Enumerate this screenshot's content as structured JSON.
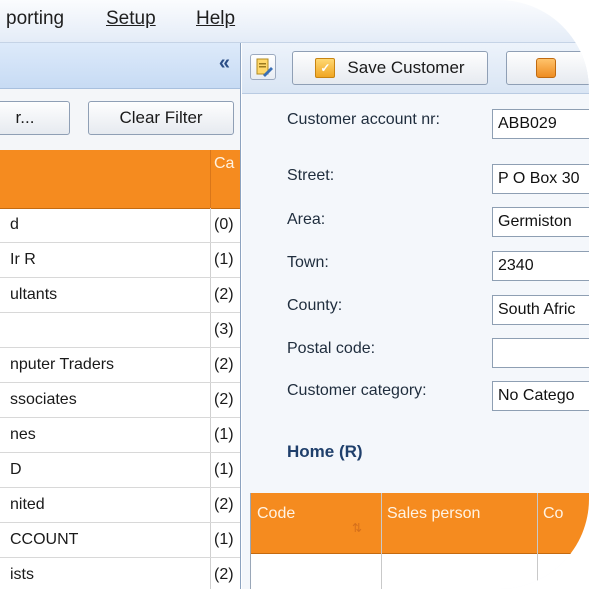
{
  "menu": {
    "reporting": "porting",
    "setup": "Setup",
    "help": "Help"
  },
  "left_panel": {
    "collapse_glyph": "«",
    "filter_button": "r...",
    "clear_filter_button": "Clear Filter",
    "category_column": "Ca",
    "rows": [
      {
        "name": "d",
        "count": "(0)"
      },
      {
        "name": "Ir R",
        "count": "(1)"
      },
      {
        "name": "ultants",
        "count": "(2)"
      },
      {
        "name": "",
        "count": "(3)"
      },
      {
        "name": "nputer Traders",
        "count": "(2)"
      },
      {
        "name": "ssociates",
        "count": "(2)"
      },
      {
        "name": "nes",
        "count": "(1)"
      },
      {
        "name": "D",
        "count": "(1)"
      },
      {
        "name": "nited",
        "count": "(2)"
      },
      {
        "name": "CCOUNT",
        "count": "(1)"
      },
      {
        "name": "ists",
        "count": "(2)"
      }
    ]
  },
  "toolbar": {
    "save_customer": "Save Customer",
    "icons": [
      "edit-document-icon",
      "save-icon",
      "refresh-icon"
    ]
  },
  "form": {
    "account_label": "Customer account nr:",
    "account_value": "ABB029",
    "street_label": "Street:",
    "street_value": "P O Box 30",
    "area_label": "Area:",
    "area_value": "Germiston",
    "town_label": "Town:",
    "town_value": "2340",
    "county_label": "County:",
    "county_value": "South Afric",
    "postal_label": "Postal code:",
    "postal_value": "",
    "category_label": "Customer category:",
    "category_value": "No Catego"
  },
  "home_section": {
    "title": "Home (R)",
    "columns": [
      "Code",
      "Sales person",
      "Co"
    ]
  },
  "colors": {
    "accent_orange": "#f58b1f",
    "header_blue": "#d9e5f4",
    "title_blue": "#1f3f6b"
  }
}
